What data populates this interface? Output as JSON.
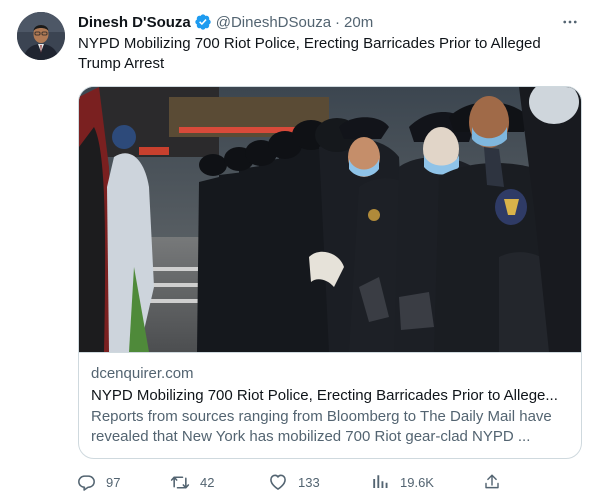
{
  "author": {
    "display_name": "Dinesh D'Souza",
    "handle": "@DineshDSouza",
    "separator": "·",
    "time": "20m"
  },
  "tweet": {
    "text": "NYPD Mobilizing 700 Riot Police, Erecting Barricades Prior to Alleged Trump Arrest"
  },
  "card": {
    "domain": "dcenquirer.com",
    "title": "NYPD Mobilizing 700 Riot Police, Erecting Barricades Prior to Allege...",
    "description": "Reports from sources ranging from Bloomberg to The Daily Mail have revealed that New York has mobilized 700 Riot gear-clad NYPD ..."
  },
  "actions": {
    "replies": "97",
    "retweets": "42",
    "likes": "133",
    "views": "19.6K"
  },
  "icons": {
    "verified": "verified-badge-icon",
    "more": "more-horizontal-icon",
    "reply": "reply-icon",
    "retweet": "retweet-icon",
    "like": "heart-icon",
    "views": "views-chart-icon",
    "share": "share-icon"
  },
  "colors": {
    "accent": "#1d9bf0",
    "text_primary": "#0f1419",
    "text_secondary": "#536471",
    "border": "#cfd9de"
  }
}
